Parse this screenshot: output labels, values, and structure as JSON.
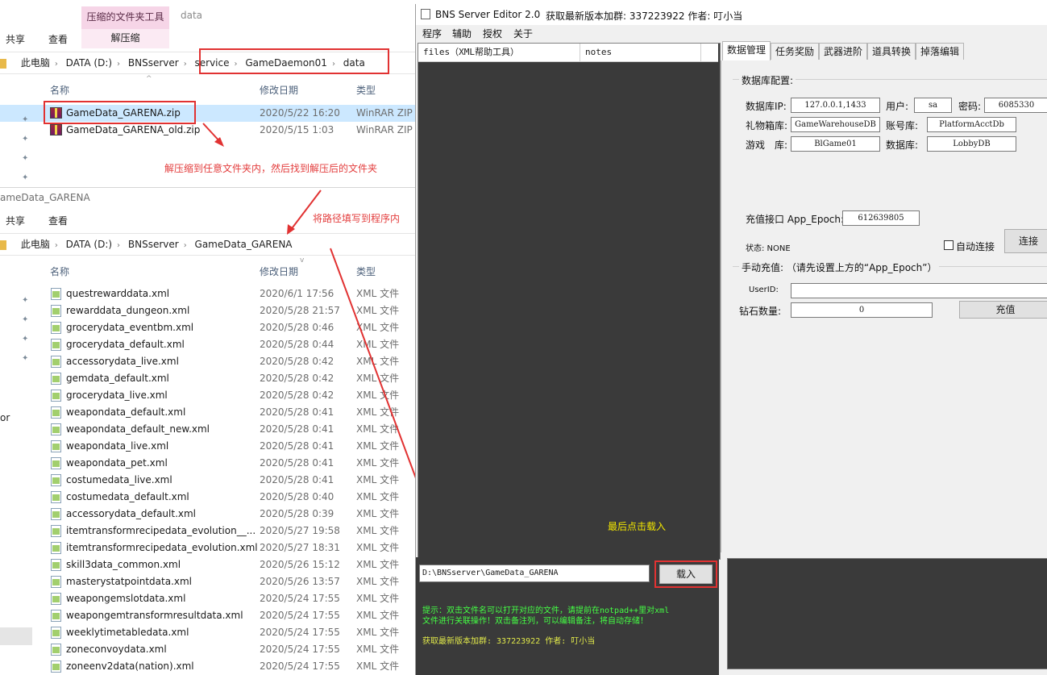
{
  "explorer1": {
    "ribbon": {
      "share": "共享",
      "view": "查看",
      "context_header": "压缩的文件夹工具",
      "context_tab": "解压缩",
      "window_title": "data"
    },
    "address": [
      "此电脑",
      "DATA (D:)",
      "BNSserver",
      "service",
      "GameDaemon01",
      "data"
    ],
    "columns": {
      "name": "名称",
      "date": "修改日期",
      "type": "类型"
    },
    "files": [
      {
        "name": "GameData_GARENA.zip",
        "date": "2020/5/22 16:20",
        "type": "WinRAR ZIP"
      },
      {
        "name": "GameData_GARENA_old.zip",
        "date": "2020/5/15 1:03",
        "type": "WinRAR ZIP"
      }
    ],
    "note": "解压缩到任意文件夹内，然后找到解压后的文件夹"
  },
  "explorer2": {
    "window_title": "ameData_GARENA",
    "ribbon": {
      "share": "共享",
      "view": "查看"
    },
    "address": [
      "此电脑",
      "DATA (D:)",
      "BNSserver",
      "GameData_GARENA"
    ],
    "columns": {
      "name": "名称",
      "date": "修改日期",
      "type": "类型"
    },
    "note": "将路径填写到程序内",
    "side_text": "or",
    "files": [
      {
        "name": "questrewarddata.xml",
        "date": "2020/6/1 17:56",
        "type": "XML 文件"
      },
      {
        "name": "rewarddata_dungeon.xml",
        "date": "2020/5/28 21:57",
        "type": "XML 文件"
      },
      {
        "name": "grocerydata_eventbm.xml",
        "date": "2020/5/28 0:46",
        "type": "XML 文件"
      },
      {
        "name": "grocerydata_default.xml",
        "date": "2020/5/28 0:44",
        "type": "XML 文件"
      },
      {
        "name": "accessorydata_live.xml",
        "date": "2020/5/28 0:42",
        "type": "XML 文件"
      },
      {
        "name": "gemdata_default.xml",
        "date": "2020/5/28 0:42",
        "type": "XML 文件"
      },
      {
        "name": "grocerydata_live.xml",
        "date": "2020/5/28 0:42",
        "type": "XML 文件"
      },
      {
        "name": "weapondata_default.xml",
        "date": "2020/5/28 0:41",
        "type": "XML 文件"
      },
      {
        "name": "weapondata_default_new.xml",
        "date": "2020/5/28 0:41",
        "type": "XML 文件"
      },
      {
        "name": "weapondata_live.xml",
        "date": "2020/5/28 0:41",
        "type": "XML 文件"
      },
      {
        "name": "weapondata_pet.xml",
        "date": "2020/5/28 0:41",
        "type": "XML 文件"
      },
      {
        "name": "costumedata_live.xml",
        "date": "2020/5/28 0:41",
        "type": "XML 文件"
      },
      {
        "name": "costumedata_default.xml",
        "date": "2020/5/28 0:40",
        "type": "XML 文件"
      },
      {
        "name": "accessorydata_default.xml",
        "date": "2020/5/28 0:39",
        "type": "XML 文件"
      },
      {
        "name": "itemtransformrecipedata_evolution__...",
        "date": "2020/5/27 19:58",
        "type": "XML 文件"
      },
      {
        "name": "itemtransformrecipedata_evolution.xml",
        "date": "2020/5/27 18:31",
        "type": "XML 文件"
      },
      {
        "name": "skill3data_common.xml",
        "date": "2020/5/26 15:12",
        "type": "XML 文件"
      },
      {
        "name": "masterystatpointdata.xml",
        "date": "2020/5/26 13:57",
        "type": "XML 文件"
      },
      {
        "name": "weapongemslotdata.xml",
        "date": "2020/5/24 17:55",
        "type": "XML 文件"
      },
      {
        "name": "weapongemtransformresultdata.xml",
        "date": "2020/5/24 17:55",
        "type": "XML 文件"
      },
      {
        "name": "weeklytimetabledata.xml",
        "date": "2020/5/24 17:55",
        "type": "XML 文件"
      },
      {
        "name": "zoneconvoydata.xml",
        "date": "2020/5/24 17:55",
        "type": "XML 文件"
      },
      {
        "name": "zoneenv2data(nation).xml",
        "date": "2020/5/24 17:55",
        "type": "XML 文件"
      }
    ]
  },
  "editor": {
    "title": "BNS Server Editor 2.0",
    "title_info": "获取最新版本加群: 337223922 作者: 叮小当",
    "menu": [
      "程序",
      "辅助",
      "授权",
      "关于"
    ],
    "list_headers": {
      "files": "files（XML帮助工具）",
      "notes": "notes"
    },
    "path_value": "D:\\BNSserver\\GameData_GARENA",
    "load_button": "载入",
    "hint_note": "最后点击载入",
    "tips_line1": "提示：双击文件名可以打开对应的文件，请提前在notpad++里对xml",
    "tips_line2": "文件进行关联操作！双击备注列，可以编辑备注，将自动存储！",
    "group_line": "获取最新版本加群: 337223922 作者: 叮小当",
    "tabs": [
      "数据管理",
      "任务奖励",
      "武器进阶",
      "道具转换",
      "掉落编辑"
    ],
    "db": {
      "group_label": "数据库配置:",
      "ip_label": "数据库IP:",
      "ip_value": "127.0.0.1,1433",
      "user_label": "用户:",
      "user_value": "sa",
      "pwd_label": "密码:",
      "pwd_value": "6085330",
      "gift_label": "礼物箱库:",
      "gift_value": "GameWarehouseDB",
      "acct_label": "账号库:",
      "acct_value": "PlatformAcctDb",
      "game_label": "游戏　库:",
      "game_value": "BlGame01",
      "dbname_label": "数据库:",
      "dbname_value": "LobbyDB"
    },
    "recharge": {
      "api_label": "充值接口 App_Epoch:",
      "api_value": "612639805",
      "status_label": "状态: NONE",
      "auto_connect": "自动连接",
      "connect_button": "连接",
      "manual_label": "手动充值: （请先设置上方的“App_Epoch”）",
      "userid_label": "UserID:",
      "userid_value": "",
      "diamond_label": "钻石数量:",
      "diamond_value": "0",
      "recharge_button": "充值"
    }
  },
  "colors": {
    "accent_red": "#e13232",
    "terminal_green": "#44ff44",
    "dark_panel": "#3a3a3a"
  }
}
